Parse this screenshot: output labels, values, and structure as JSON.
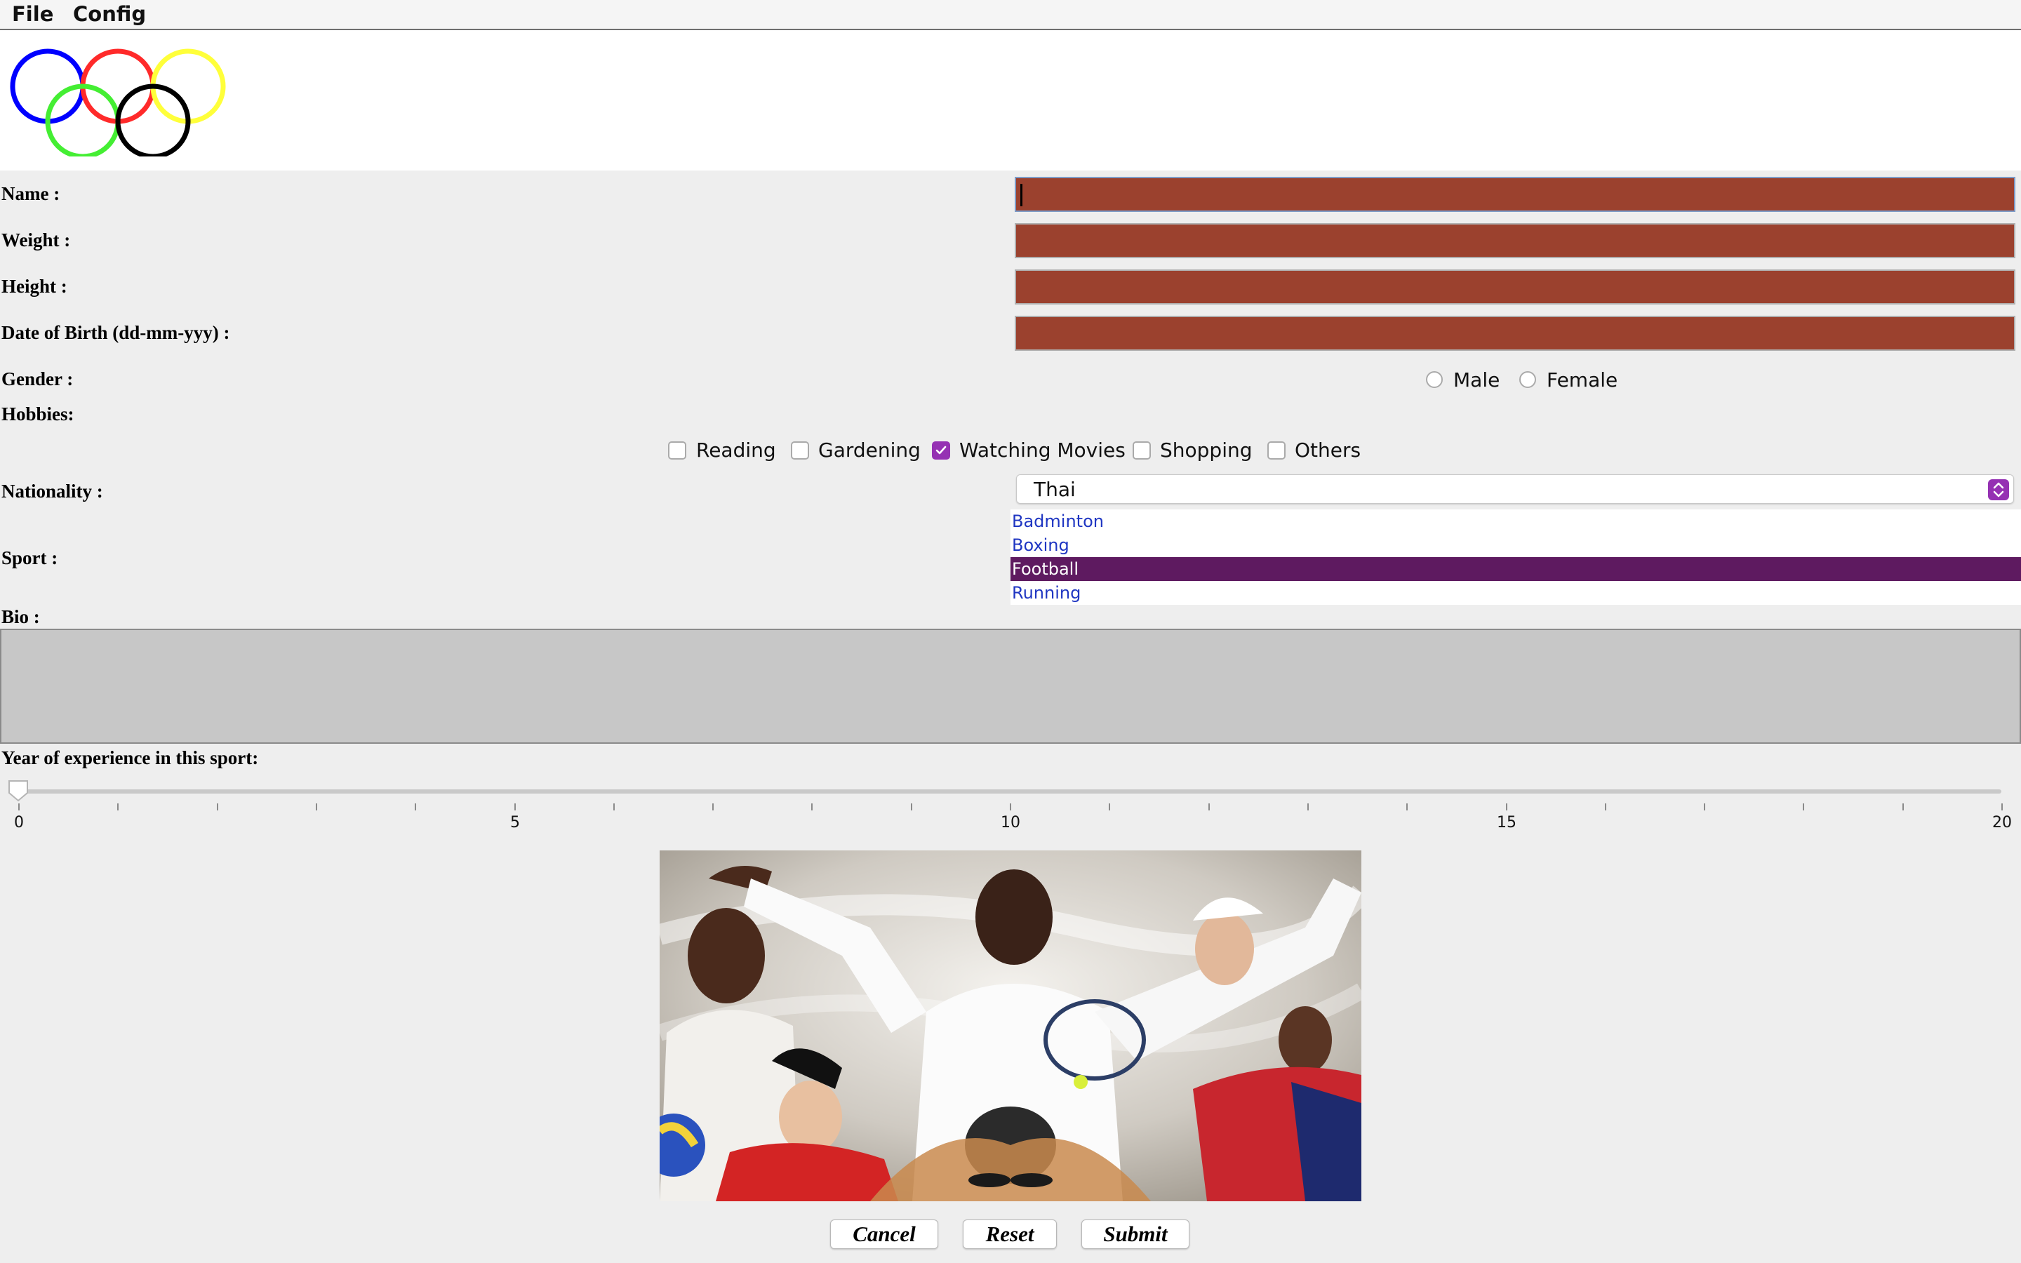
{
  "menubar": {
    "items": [
      "File",
      "Config"
    ]
  },
  "logo": {
    "ring_colors": [
      "#0000ff",
      "#ff2a2a",
      "#ffff3a",
      "#44ee33",
      "#000000"
    ]
  },
  "form": {
    "name_label": "Name :",
    "weight_label": "Weight :",
    "height_label": "Height :",
    "dob_label": "Date of Birth (dd-mm-yyy) :",
    "gender_label": "Gender :",
    "hobbies_label": "Hobbies:",
    "nationality_label": "Nationality :",
    "sport_label": "Sport :",
    "bio_label": "Bio :",
    "experience_label": "Year of experience in this sport:",
    "name_value": "",
    "weight_value": "",
    "height_value": "",
    "dob_value": "",
    "field_color": "#9b412e"
  },
  "gender": {
    "options": [
      {
        "label": "Male",
        "selected": false
      },
      {
        "label": "Female",
        "selected": false
      }
    ]
  },
  "hobbies": {
    "options": [
      {
        "label": "Reading",
        "checked": false
      },
      {
        "label": "Gardening",
        "checked": false
      },
      {
        "label": "Watching Movies",
        "checked": true
      },
      {
        "label": "Shopping",
        "checked": false
      },
      {
        "label": "Others",
        "checked": false
      }
    ]
  },
  "nationality": {
    "selected": "Thai"
  },
  "sport": {
    "items": [
      "Badminton",
      "Boxing",
      "Football",
      "Running"
    ],
    "selected_index": 2
  },
  "bio": {
    "value": ""
  },
  "experience": {
    "min": 0,
    "max": 20,
    "value": 0,
    "major_labels": [
      "0",
      "5",
      "10",
      "15",
      "20"
    ]
  },
  "buttons": {
    "cancel": "Cancel",
    "reset": "Reset",
    "submit": "Submit"
  },
  "colors": {
    "accent": "#9531b3",
    "selection": "#5e1a60",
    "link": "#1f36c2"
  }
}
